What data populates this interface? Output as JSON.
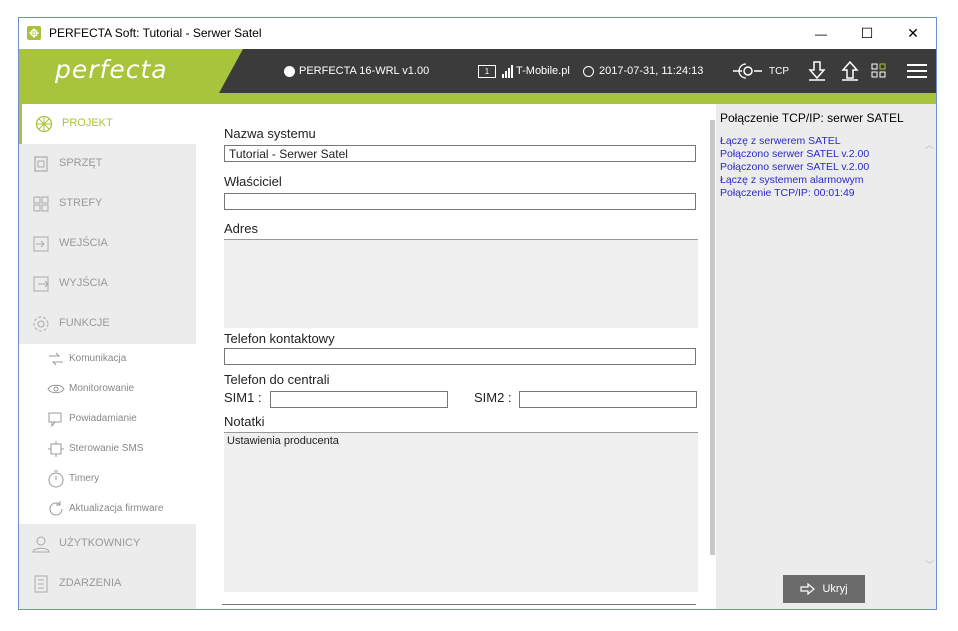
{
  "window": {
    "title": "PERFECTA Soft: Tutorial - Serwer Satel",
    "minimize": "—",
    "maximize": "☐",
    "close": "✕"
  },
  "header": {
    "logo": "perfecta",
    "device": "PERFECTA 16-WRL v1.00",
    "sim_slot": "1",
    "operator": "T-Mobile.pl",
    "datetime": "2017-07-31, 11:24:13",
    "connection": "TCP"
  },
  "sidebar": {
    "items": [
      {
        "label": "PROJEKT",
        "icon": "flower-icon"
      },
      {
        "label": "SPRZĘT",
        "icon": "device-icon"
      },
      {
        "label": "STREFY",
        "icon": "zones-icon"
      },
      {
        "label": "WEJŚCIA",
        "icon": "input-icon"
      },
      {
        "label": "WYJŚCIA",
        "icon": "output-icon"
      },
      {
        "label": "FUNKCJE",
        "icon": "gear-icon"
      }
    ],
    "subitems": [
      {
        "label": "Komunikacja",
        "icon": "communication-icon"
      },
      {
        "label": "Monitorowanie",
        "icon": "eye-icon"
      },
      {
        "label": "Powiadamianie",
        "icon": "notify-icon"
      },
      {
        "label": "Sterowanie SMS",
        "icon": "sms-control-icon"
      },
      {
        "label": "Timery",
        "icon": "timer-icon"
      },
      {
        "label": "Aktualizacja firmware",
        "icon": "update-icon"
      }
    ],
    "bottom": [
      {
        "label": "UŻYTKOWNICY",
        "icon": "user-icon"
      },
      {
        "label": "ZDARZENIA",
        "icon": "events-icon"
      }
    ]
  },
  "form": {
    "system_name_label": "Nazwa systemu",
    "system_name_value": "Tutorial - Serwer Satel",
    "owner_label": "Właściciel",
    "owner_value": "",
    "address_label": "Adres",
    "address_value": "",
    "contact_phone_label": "Telefon kontaktowy",
    "contact_phone_value": "",
    "panel_phone_label": "Telefon do centrali",
    "sim1_label": "SIM1 :",
    "sim1_value": "",
    "sim2_label": "SIM2 :",
    "sim2_value": "",
    "notes_label": "Notatki",
    "notes_value": "Ustawienia producenta"
  },
  "connection_panel": {
    "title": "Połączenie TCP/IP: serwer SATEL",
    "log": [
      "Łączę z serwerem SATEL",
      "Połączono serwer SATEL v.2.00",
      "Połączono serwer SATEL v.2.00",
      "Łączę z systemem alarmowym",
      "Połączenie TCP/IP: 00:01:49"
    ],
    "hide_button": "Ukryj"
  },
  "colors": {
    "accent": "#a8c43c",
    "header_bg": "#3b3b3b",
    "log_text": "#2a2ac8"
  }
}
